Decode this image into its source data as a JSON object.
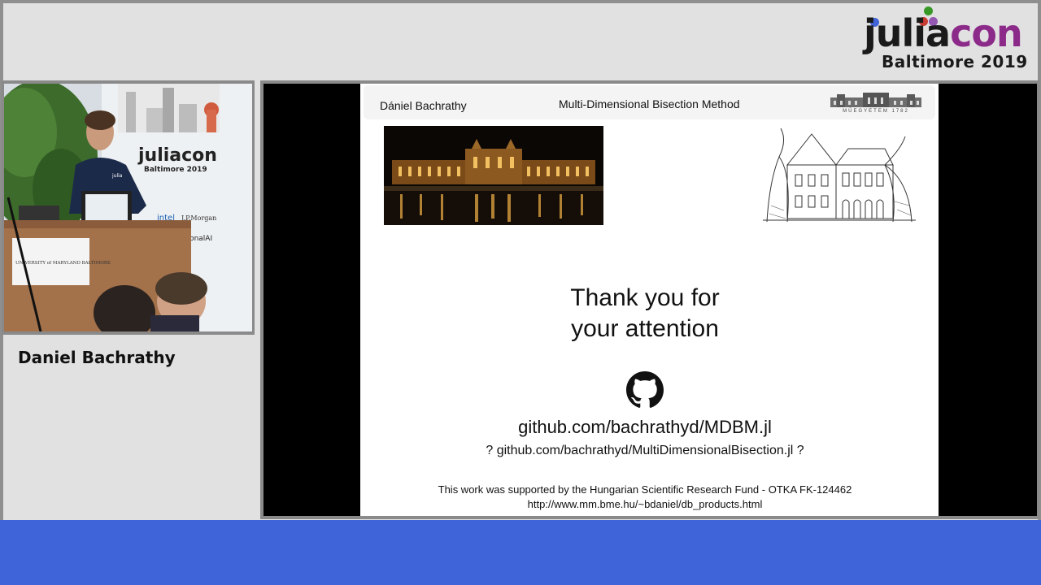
{
  "logo": {
    "word_main": "julia",
    "word_accent": "con",
    "subtitle": "Baltimore 2019",
    "dot_colors": [
      "#4063d8",
      "#389826",
      "#9558b2",
      "#cb3c33"
    ]
  },
  "speaker": {
    "name": "Daniel Bachrathy"
  },
  "webcam": {
    "banner_word": "juliacon",
    "banner_sub": "Baltimore 2019",
    "sponsors": [
      "intel",
      "J.P.Morgan",
      "relationalAI"
    ],
    "podium_sign": "UNIVERSITY of MARYLAND BALTIMORE",
    "shirt_text": "julia"
  },
  "slide": {
    "header": {
      "author": "Dániel Bachrathy",
      "title": "Multi-Dimensional Bisection Method",
      "logo_text": "MŰEGYETEM 1782"
    },
    "thanks_line1": "Thank you for",
    "thanks_line2": "your attention",
    "github_icon": "github-icon",
    "link_main": "github.com/bachrathyd/MDBM.jl",
    "link_alt": "? github.com/bachrathyd/MultiDimensionalBisection.jl ?",
    "funding": "This work was supported by the Hungarian Scientific Research Fund - OTKA FK-124462",
    "funding_url": "http://www.mm.bme.hu/~bdaniel/db_products.html"
  },
  "colors": {
    "background": "#e1e1e1",
    "bottom_bar": "#3f64d9",
    "julia_purple": "#8c2a8a"
  }
}
